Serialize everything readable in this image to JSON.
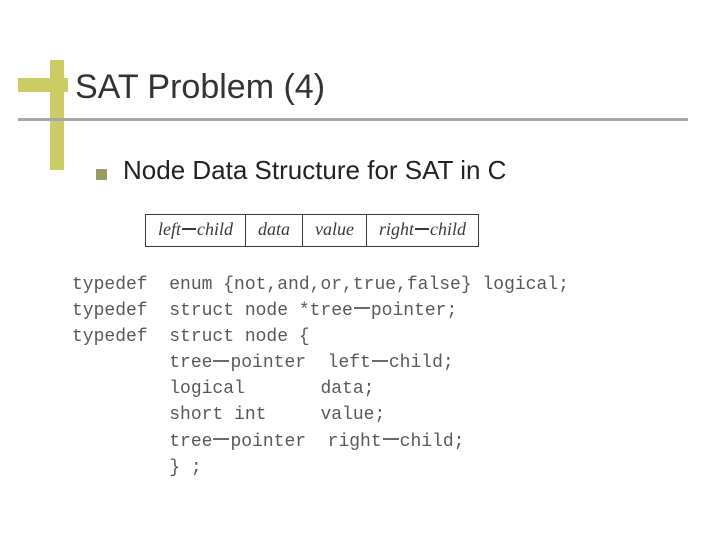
{
  "title": "SAT Problem (4)",
  "bullet": "Node Data Structure for SAT in C",
  "fields": {
    "c1a": "left",
    "c1b": "child",
    "c2": "data",
    "c3": "value",
    "c4a": "right",
    "c4b": "child"
  },
  "code": {
    "l1a": "typedef  enum {not,and,or,true,false} logical;",
    "l2a": "typedef  struct node *tree",
    "l2b": "pointer;",
    "l3a": "typedef  struct node {",
    "l4a": "         tree",
    "l4b": "pointer  left",
    "l4c": "child;",
    "l5a": "         logical       data;",
    "l6a": "         short int     value;",
    "l7a": "         tree",
    "l7b": "pointer  right",
    "l7c": "child;",
    "l8a": "         } ;"
  }
}
